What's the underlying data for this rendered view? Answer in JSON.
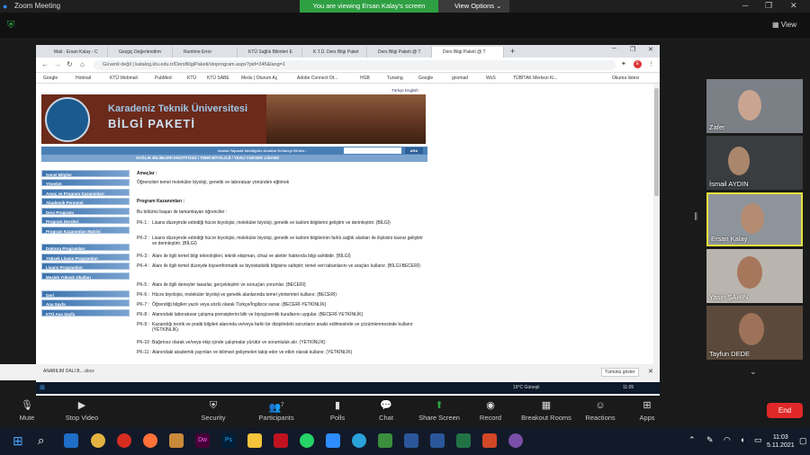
{
  "zoom": {
    "title": "Zoom Meeting",
    "share_banner": "You are viewing Ersan Kalay's screen",
    "view_options": "View Options",
    "view_label": "View"
  },
  "browser": {
    "tabs": [
      "Mail - Ersan Kalay - C",
      "Gezgiç Değerlendirm",
      "Runtime Error",
      "KTÜ Sağlık Bilimleri E",
      "K.T.Ü. Ders Bilgi Paket",
      "Ders Bilgi Paketi @ T",
      "Ders Bilgi Paketi @ T"
    ],
    "url": "Güvenli değil | katalog.ktu.edu.tr/DersBilgiPaketi/oloprogram.aspx?pid=345&lang=1",
    "bookmarks": [
      "Google",
      "Hotmail",
      "KTÜ Webmail",
      "PubMed",
      "KTÜ",
      "KTÜ SABE",
      "Medu | Oturum Aç",
      "Adobe Connect Ot...",
      "HGB",
      "Turwing",
      "Google",
      "gnomad",
      "WoS",
      "TÜBİTAK Merkezi Ki...",
      "Okuma listesi"
    ]
  },
  "site": {
    "lang_links": "Türkçe English",
    "banner_line1": "Karadeniz Teknik Üniversitesi",
    "banner_line2": "BİLGİ PAKETİ",
    "search_label": "Arama Yapmak İstediğiniz Anahtar Kelimeyi Giriniz :",
    "search_button": "ARA",
    "breadcrumb": "SAĞLIK BİLİMLERİ ENSTİTÜSÜ / TIBBİ BİYOLOJİ / TEZLİ YÜKSEK LİSANS",
    "sidebar": [
      "Genel Bilgiler",
      "Yönetim",
      "Amaç ve Program Kazanımları",
      "Akademik Personel",
      "Ders Programı",
      "Program Dersleri",
      "Program Kazanımları Matrisi",
      "Doktora Programları",
      "Yüksek Lisans Programları",
      "Lisans Programları",
      "Meslek Yüksek Okulları",
      "Geri",
      "Ana Sayfa",
      "KTÜ Ana Sayfa"
    ],
    "aims_title": "Amaçlar :",
    "aims_text": "Öğrencileri temel moleküler biyoloji, genetik ve laboratuar yönünden eğitmek",
    "outcomes_title": "Program Kazanımları :",
    "outcomes_intro": "Bu bölümü başarı ile tamamlayan öğrenciler :",
    "outcomes": [
      {
        "id": "PK-1 :",
        "text": "Lisans düzeyinde edindiği hücre biyolojisi, moleküler biyoloji, genetik ve kalıtım bilgilerini geliştirir ve derinleştirir. (BİLGİ)"
      },
      {
        "id": "PK-2 :",
        "text": "Lisans düzeyinde edindiği hücre biyolojisi, moleküler biyoloji, genetik ve kalıtım bilgilerinin farklı sağlık alanları ile ilişkisini kavrar geliştirir ve derinleştirir. (BİLGİ)"
      },
      {
        "id": "PK-3 :",
        "text": "Alanı ile ilgili temel bilgi teknolojileri, teknik ekipman, cihaz ve aletler hakkında bilgi sahibidir. (BİLGİ)"
      },
      {
        "id": "PK-4 :",
        "text": "Alanı ile ilgili temel düzeyde biyoenformatik ve biyoistatistik bilgisine sahiptir; temel veri tabanlarını ve araçları kullanır. (BİLGİ-BECERİ)"
      },
      {
        "id": "PK-5 :",
        "text": "Alanı ile ilgili deneyler tasarlar, gerçekleştirir ve sonuçları yorumlar. (BECERİ)"
      },
      {
        "id": "PK-6 :",
        "text": "Hücre biyolojisi, moleküler biyoloji ve genetik alanlarında temel yöntemleri kullanır. (BECERİ)"
      },
      {
        "id": "PK-7 :",
        "text": "Öğrendiği bilgileri yazılı veya sözlü olarak Türkçe/İngilizce sunar. (BECERİ-YETKİNLİK)"
      },
      {
        "id": "PK-8 :",
        "text": "Alanındaki laboratuvar çalışma prensiplerini bilir ve biyogüvenlik kurallarını uygular. (BECERİ-YETKİNLİK)"
      },
      {
        "id": "PK-9 :",
        "text": "Kazandığı teorik ve pratik bilgileri alanında ve/veya farklı bir disiplindeki sorunların analiz edilmesinde ve çözümlenmesinde kullanır (YETKİNLİK)."
      },
      {
        "id": "PK-10 :",
        "text": "Bağımsız olarak ve/veya ekip içinde çalışmalar yürütür ve sorumluluk alır. (YETKİNLİK)"
      },
      {
        "id": "PK-11 :",
        "text": "Alanındaki akademik yayınları ve bilimsel gelişmeleri takip eder ve etkin olarak kullanır. (YETKİNLİK)"
      }
    ]
  },
  "downloads": {
    "file": "ANABİLİM DALI B....docx",
    "show_all": "Tümünü göster"
  },
  "inner_taskbar": {
    "weather": "19°C Güneşli",
    "time": "11:05"
  },
  "participants": [
    {
      "name": "Zafer",
      "bg": "#7b7f86"
    },
    {
      "name": "İsmail AYDIN",
      "bg": "#3a3d3f"
    },
    {
      "name": "Ersan Kalay",
      "bg": "#8e949c"
    },
    {
      "name": "Yasin ŞAHİN",
      "bg": "#b9b5ae"
    },
    {
      "name": "Tayfun DEDE",
      "bg": "#5b4a3c"
    }
  ],
  "toolbar": {
    "mute": "Mute",
    "stop_video": "Stop Video",
    "security": "Security",
    "participants": "Participants",
    "participants_count": "7",
    "polls": "Polls",
    "chat": "Chat",
    "share_screen": "Share Screen",
    "record": "Record",
    "breakout": "Breakout Rooms",
    "reactions": "Reactions",
    "apps": "Apps",
    "end": "End"
  },
  "taskbar": {
    "time": "11:03",
    "date": "5.11.2021"
  },
  "colors": {
    "accent_green": "#2ea043",
    "end_red": "#e02828",
    "active_speaker": "#e8e23a"
  }
}
